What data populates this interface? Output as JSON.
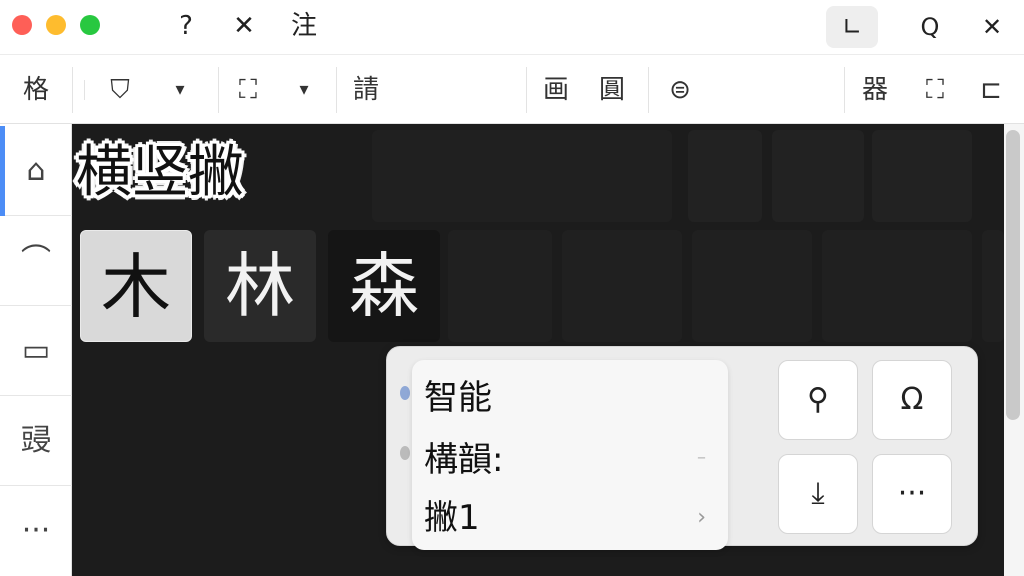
{
  "titlebar": {
    "glyph_help": "?",
    "glyph_close_x": "✕",
    "glyph_law": "注",
    "btn_window": "∟",
    "btn_search": "Q",
    "btn_close": "✕"
  },
  "toolbar": {
    "format": "格",
    "shield": "⛉",
    "shield_dropdown": "▾",
    "crop": "⛶",
    "crop_dropdown": "▾",
    "please": "請",
    "picture1": "画",
    "picture2": "圓",
    "link": "⊜",
    "layout": "器",
    "select": "⛶",
    "back": "⊏"
  },
  "sidebar": {
    "items": [
      {
        "label": "⌂",
        "active": true
      },
      {
        "label": "⌒"
      },
      {
        "label": "▭"
      },
      {
        "label": "䜷"
      },
      {
        "label": "···"
      }
    ]
  },
  "canvas": {
    "title": "横竖撇",
    "tiles": [
      "木",
      "林",
      "森"
    ]
  },
  "panel": {
    "menu": [
      {
        "label": "智能"
      },
      {
        "label": "構韻:"
      },
      {
        "label": "撇1",
        "has_submenu": true,
        "chevron": "›"
      }
    ],
    "dash": "–",
    "buttons": [
      {
        "name": "help",
        "glyph": "⚲"
      },
      {
        "name": "symbol",
        "glyph": "Ω"
      },
      {
        "name": "import",
        "glyph": "⤓"
      },
      {
        "name": "more",
        "glyph": "···"
      }
    ]
  },
  "colors": {
    "accent": "#4c8df6",
    "canvas_bg": "#1c1c1c",
    "close_dot": "#fe5f57",
    "minimize_dot": "#febc2e",
    "zoom_dot": "#28c840"
  }
}
